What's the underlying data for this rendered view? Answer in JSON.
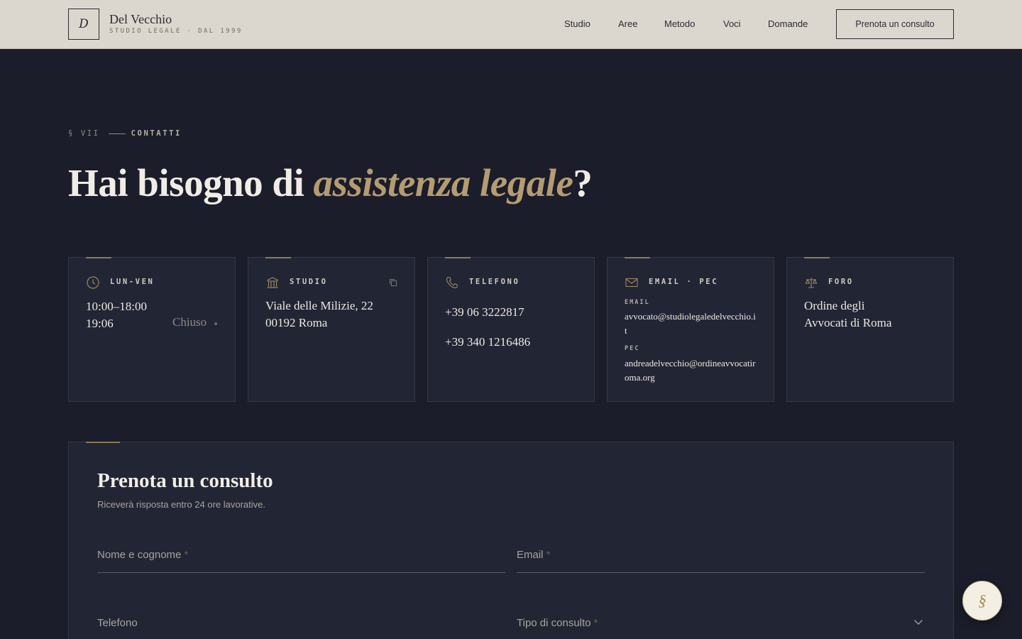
{
  "header": {
    "logo_letter": "D",
    "brand_name": "Del Vecchio",
    "brand_sub": "STUDIO LEGALE · DAL 1999",
    "nav": [
      "Studio",
      "Aree",
      "Metodo",
      "Voci",
      "Domande"
    ],
    "cta": "Prenota un consulto"
  },
  "section": {
    "number": "§ VII",
    "kicker": "CONTATTI",
    "title_start": "Hai bisogno di ",
    "title_accent": "assistenza legale",
    "title_end": "?"
  },
  "cards": {
    "hours": {
      "icon": "clock-icon",
      "label": "LUN-VEN",
      "hours": "10:00–18:00",
      "time": "19:06",
      "status": "Chiuso"
    },
    "studio": {
      "icon": "building-icon",
      "label": "STUDIO",
      "line1": "Viale delle Milizie, 22",
      "line2": "00192 Roma"
    },
    "phone": {
      "icon": "phone-icon",
      "label": "TELEFONO",
      "phone1": "+39 06 3222817",
      "phone2": "+39 340 1216486"
    },
    "email": {
      "icon": "mail-icon",
      "label": "EMAIL · PEC",
      "email_label": "EMAIL",
      "email": "avvocato@studiolegaledelvecchio.it",
      "pec_label": "PEC",
      "pec": "andreadelvecchio@ordineavvocatiroma.org"
    },
    "foro": {
      "icon": "scales-icon",
      "label": "FORO",
      "line1": "Ordine degli",
      "line2": "Avvocati di Roma"
    }
  },
  "form": {
    "title": "Prenota un consulto",
    "subtitle": "Riceverà risposta entro 24 ore lavorative.",
    "fields": {
      "name": "Nome e cognome",
      "email": "Email",
      "phone": "Telefono",
      "type": "Tipo di consulto"
    },
    "required_mark": "*"
  },
  "fab": {
    "symbol": "§"
  },
  "colors": {
    "accent": "#b49c72",
    "background": "#1b1d2a",
    "card": "#222534",
    "header": "#dcd7ce"
  }
}
